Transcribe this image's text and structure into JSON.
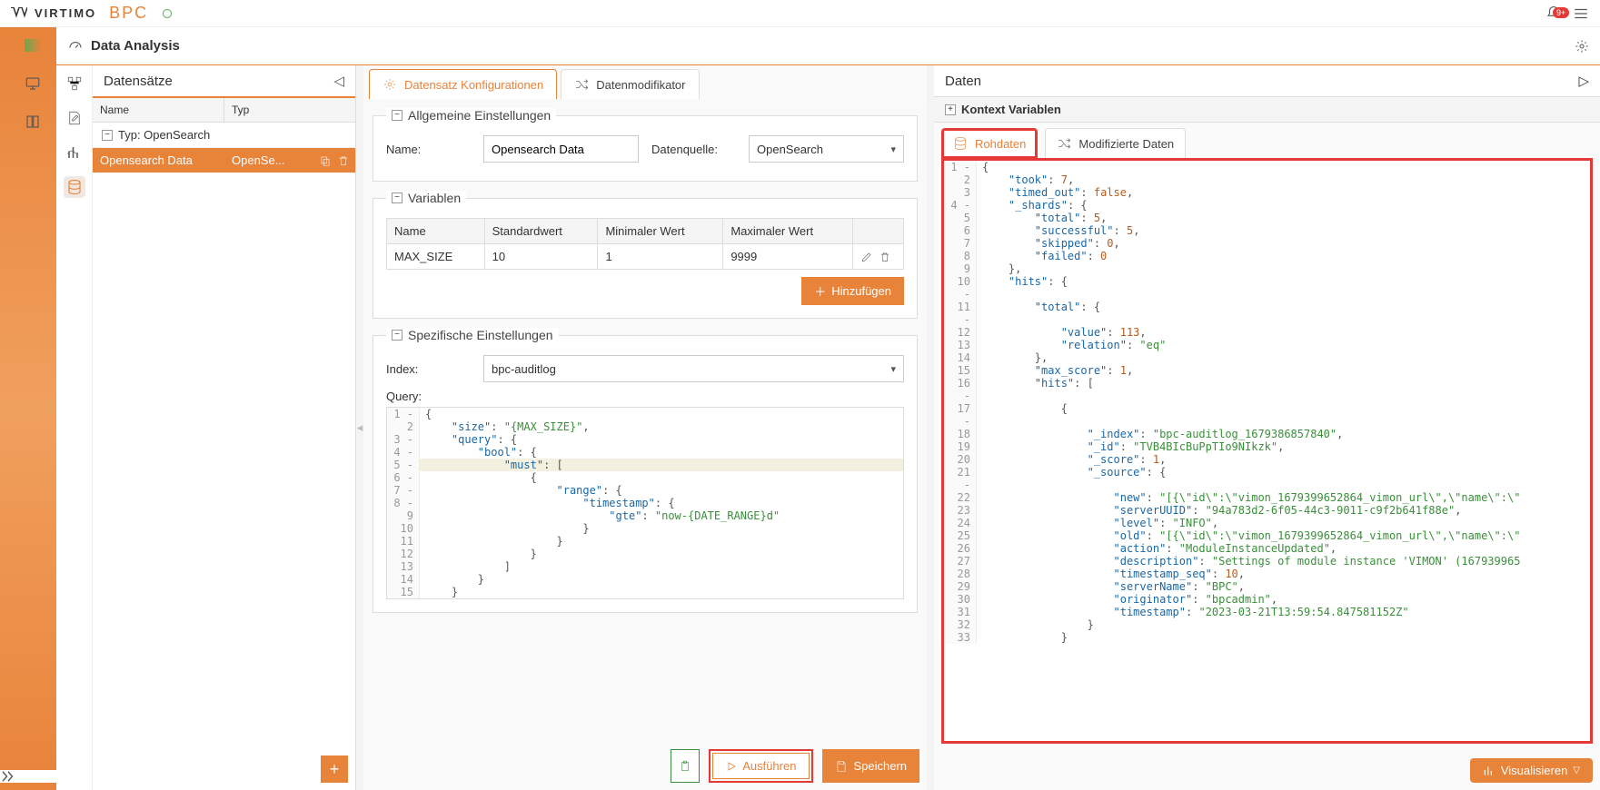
{
  "header": {
    "brand_main": "VIRTIMO",
    "brand_sub": "BPC",
    "badge": "9+"
  },
  "page": {
    "title": "Data Analysis"
  },
  "datasets": {
    "panel_title": "Datensätze",
    "columns": {
      "name": "Name",
      "type": "Typ"
    },
    "group_label": "Typ: OpenSearch",
    "rows": [
      {
        "name": "Opensearch Data",
        "type": "OpenSe..."
      }
    ]
  },
  "center": {
    "tabs": {
      "config": "Datensatz Konfigurationen",
      "modifier": "Datenmodifikator"
    },
    "general": {
      "legend": "Allgemeine Einstellungen",
      "name_label": "Name:",
      "name_value": "Opensearch Data",
      "source_label": "Datenquelle:",
      "source_value": "OpenSearch"
    },
    "variables": {
      "legend": "Variablen",
      "cols": {
        "name": "Name",
        "std": "Standardwert",
        "min": "Minimaler Wert",
        "max": "Maximaler Wert"
      },
      "rows": [
        {
          "name": "MAX_SIZE",
          "std": "10",
          "min": "1",
          "max": "9999"
        }
      ],
      "add_btn": "Hinzufügen"
    },
    "specific": {
      "legend": "Spezifische Einstellungen",
      "index_label": "Index:",
      "index_value": "bpc-auditlog",
      "query_label": "Query:"
    },
    "query_lines": [
      {
        "n": "1",
        "fold": "-",
        "tokens": [
          {
            "t": "{",
            "c": "p"
          }
        ]
      },
      {
        "n": "2",
        "tokens": [
          {
            "t": "    ",
            "c": "p"
          },
          {
            "t": "\"size\"",
            "c": "k"
          },
          {
            "t": ": ",
            "c": "p"
          },
          {
            "t": "\"{MAX_SIZE}\"",
            "c": "s"
          },
          {
            "t": ",",
            "c": "p"
          }
        ]
      },
      {
        "n": "3",
        "fold": "-",
        "tokens": [
          {
            "t": "    ",
            "c": "p"
          },
          {
            "t": "\"query\"",
            "c": "k"
          },
          {
            "t": ": {",
            "c": "p"
          }
        ]
      },
      {
        "n": "4",
        "fold": "-",
        "tokens": [
          {
            "t": "        ",
            "c": "p"
          },
          {
            "t": "\"bool\"",
            "c": "k"
          },
          {
            "t": ": {",
            "c": "p"
          }
        ]
      },
      {
        "n": "5",
        "fold": "-",
        "hl": true,
        "tokens": [
          {
            "t": "            ",
            "c": "p"
          },
          {
            "t": "\"must\"",
            "c": "k"
          },
          {
            "t": ": [",
            "c": "p"
          }
        ]
      },
      {
        "n": "6",
        "fold": "-",
        "tokens": [
          {
            "t": "                {",
            "c": "p"
          }
        ]
      },
      {
        "n": "7",
        "fold": "-",
        "tokens": [
          {
            "t": "                    ",
            "c": "p"
          },
          {
            "t": "\"range\"",
            "c": "k"
          },
          {
            "t": ": {",
            "c": "p"
          }
        ]
      },
      {
        "n": "8",
        "fold": "-",
        "tokens": [
          {
            "t": "                        ",
            "c": "p"
          },
          {
            "t": "\"timestamp\"",
            "c": "k"
          },
          {
            "t": ": {",
            "c": "p"
          }
        ]
      },
      {
        "n": "9",
        "tokens": [
          {
            "t": "                            ",
            "c": "p"
          },
          {
            "t": "\"gte\"",
            "c": "k"
          },
          {
            "t": ": ",
            "c": "p"
          },
          {
            "t": "\"now-{DATE_RANGE}d\"",
            "c": "s"
          }
        ]
      },
      {
        "n": "10",
        "tokens": [
          {
            "t": "                        }",
            "c": "p"
          }
        ]
      },
      {
        "n": "11",
        "tokens": [
          {
            "t": "                    }",
            "c": "p"
          }
        ]
      },
      {
        "n": "12",
        "tokens": [
          {
            "t": "                }",
            "c": "p"
          }
        ]
      },
      {
        "n": "13",
        "tokens": [
          {
            "t": "            ]",
            "c": "p"
          }
        ]
      },
      {
        "n": "14",
        "tokens": [
          {
            "t": "        }",
            "c": "p"
          }
        ]
      },
      {
        "n": "15",
        "tokens": [
          {
            "t": "    }",
            "c": "p"
          }
        ]
      }
    ],
    "footer": {
      "execute": "Ausführen",
      "save": "Speichern"
    }
  },
  "right": {
    "title": "Daten",
    "context": "Kontext Variablen",
    "tabs": {
      "raw": "Rohdaten",
      "mod": "Modifizierte Daten"
    },
    "json_lines": [
      {
        "n": "1",
        "fold": "-",
        "tokens": [
          {
            "t": "{",
            "c": "p"
          }
        ]
      },
      {
        "n": "2",
        "tokens": [
          {
            "t": "    ",
            "c": "p"
          },
          {
            "t": "\"took\"",
            "c": "k"
          },
          {
            "t": ": ",
            "c": "p"
          },
          {
            "t": "7",
            "c": "n"
          },
          {
            "t": ",",
            "c": "p"
          }
        ]
      },
      {
        "n": "3",
        "tokens": [
          {
            "t": "    ",
            "c": "p"
          },
          {
            "t": "\"timed_out\"",
            "c": "k"
          },
          {
            "t": ": ",
            "c": "p"
          },
          {
            "t": "false",
            "c": "n"
          },
          {
            "t": ",",
            "c": "p"
          }
        ]
      },
      {
        "n": "4",
        "fold": "-",
        "tokens": [
          {
            "t": "    ",
            "c": "p"
          },
          {
            "t": "\"_shards\"",
            "c": "k"
          },
          {
            "t": ": {",
            "c": "p"
          }
        ]
      },
      {
        "n": "5",
        "tokens": [
          {
            "t": "        ",
            "c": "p"
          },
          {
            "t": "\"total\"",
            "c": "k"
          },
          {
            "t": ": ",
            "c": "p"
          },
          {
            "t": "5",
            "c": "n"
          },
          {
            "t": ",",
            "c": "p"
          }
        ]
      },
      {
        "n": "6",
        "tokens": [
          {
            "t": "        ",
            "c": "p"
          },
          {
            "t": "\"successful\"",
            "c": "k"
          },
          {
            "t": ": ",
            "c": "p"
          },
          {
            "t": "5",
            "c": "n"
          },
          {
            "t": ",",
            "c": "p"
          }
        ]
      },
      {
        "n": "7",
        "tokens": [
          {
            "t": "        ",
            "c": "p"
          },
          {
            "t": "\"skipped\"",
            "c": "k"
          },
          {
            "t": ": ",
            "c": "p"
          },
          {
            "t": "0",
            "c": "n"
          },
          {
            "t": ",",
            "c": "p"
          }
        ]
      },
      {
        "n": "8",
        "tokens": [
          {
            "t": "        ",
            "c": "p"
          },
          {
            "t": "\"failed\"",
            "c": "k"
          },
          {
            "t": ": ",
            "c": "p"
          },
          {
            "t": "0",
            "c": "n"
          }
        ]
      },
      {
        "n": "9",
        "tokens": [
          {
            "t": "    },",
            "c": "p"
          }
        ]
      },
      {
        "n": "10",
        "fold": "-",
        "tokens": [
          {
            "t": "    ",
            "c": "p"
          },
          {
            "t": "\"hits\"",
            "c": "k"
          },
          {
            "t": ": {",
            "c": "p"
          }
        ]
      },
      {
        "n": "11",
        "fold": "-",
        "tokens": [
          {
            "t": "        ",
            "c": "p"
          },
          {
            "t": "\"total\"",
            "c": "k"
          },
          {
            "t": ": {",
            "c": "p"
          }
        ]
      },
      {
        "n": "12",
        "tokens": [
          {
            "t": "            ",
            "c": "p"
          },
          {
            "t": "\"value\"",
            "c": "k"
          },
          {
            "t": ": ",
            "c": "p"
          },
          {
            "t": "113",
            "c": "n"
          },
          {
            "t": ",",
            "c": "p"
          }
        ]
      },
      {
        "n": "13",
        "tokens": [
          {
            "t": "            ",
            "c": "p"
          },
          {
            "t": "\"relation\"",
            "c": "k"
          },
          {
            "t": ": ",
            "c": "p"
          },
          {
            "t": "\"eq\"",
            "c": "s"
          }
        ]
      },
      {
        "n": "14",
        "tokens": [
          {
            "t": "        },",
            "c": "p"
          }
        ]
      },
      {
        "n": "15",
        "tokens": [
          {
            "t": "        ",
            "c": "p"
          },
          {
            "t": "\"max_score\"",
            "c": "k"
          },
          {
            "t": ": ",
            "c": "p"
          },
          {
            "t": "1",
            "c": "n"
          },
          {
            "t": ",",
            "c": "p"
          }
        ]
      },
      {
        "n": "16",
        "fold": "-",
        "tokens": [
          {
            "t": "        ",
            "c": "p"
          },
          {
            "t": "\"hits\"",
            "c": "k"
          },
          {
            "t": ": [",
            "c": "p"
          }
        ]
      },
      {
        "n": "17",
        "fold": "-",
        "tokens": [
          {
            "t": "            {",
            "c": "p"
          }
        ]
      },
      {
        "n": "18",
        "tokens": [
          {
            "t": "                ",
            "c": "p"
          },
          {
            "t": "\"_index\"",
            "c": "k"
          },
          {
            "t": ": ",
            "c": "p"
          },
          {
            "t": "\"bpc-auditlog_1679386857840\"",
            "c": "s"
          },
          {
            "t": ",",
            "c": "p"
          }
        ]
      },
      {
        "n": "19",
        "tokens": [
          {
            "t": "                ",
            "c": "p"
          },
          {
            "t": "\"_id\"",
            "c": "k"
          },
          {
            "t": ": ",
            "c": "p"
          },
          {
            "t": "\"TVB4BIcBuPpTIo9NIkzk\"",
            "c": "s"
          },
          {
            "t": ",",
            "c": "p"
          }
        ]
      },
      {
        "n": "20",
        "tokens": [
          {
            "t": "                ",
            "c": "p"
          },
          {
            "t": "\"_score\"",
            "c": "k"
          },
          {
            "t": ": ",
            "c": "p"
          },
          {
            "t": "1",
            "c": "n"
          },
          {
            "t": ",",
            "c": "p"
          }
        ]
      },
      {
        "n": "21",
        "fold": "-",
        "tokens": [
          {
            "t": "                ",
            "c": "p"
          },
          {
            "t": "\"_source\"",
            "c": "k"
          },
          {
            "t": ": {",
            "c": "p"
          }
        ]
      },
      {
        "n": "22",
        "tokens": [
          {
            "t": "                    ",
            "c": "p"
          },
          {
            "t": "\"new\"",
            "c": "k"
          },
          {
            "t": ": ",
            "c": "p"
          },
          {
            "t": "\"[{\\\"id\\\":\\\"vimon_1679399652864_vimon_url\\\",\\\"name\\\":\\\"",
            "c": "s"
          }
        ]
      },
      {
        "n": "23",
        "tokens": [
          {
            "t": "                    ",
            "c": "p"
          },
          {
            "t": "\"serverUUID\"",
            "c": "k"
          },
          {
            "t": ": ",
            "c": "p"
          },
          {
            "t": "\"94a783d2-6f05-44c3-9011-c9f2b641f88e\"",
            "c": "s"
          },
          {
            "t": ",",
            "c": "p"
          }
        ]
      },
      {
        "n": "24",
        "tokens": [
          {
            "t": "                    ",
            "c": "p"
          },
          {
            "t": "\"level\"",
            "c": "k"
          },
          {
            "t": ": ",
            "c": "p"
          },
          {
            "t": "\"INFO\"",
            "c": "s"
          },
          {
            "t": ",",
            "c": "p"
          }
        ]
      },
      {
        "n": "25",
        "tokens": [
          {
            "t": "                    ",
            "c": "p"
          },
          {
            "t": "\"old\"",
            "c": "k"
          },
          {
            "t": ": ",
            "c": "p"
          },
          {
            "t": "\"[{\\\"id\\\":\\\"vimon_1679399652864_vimon_url\\\",\\\"name\\\":\\\"",
            "c": "s"
          }
        ]
      },
      {
        "n": "26",
        "tokens": [
          {
            "t": "                    ",
            "c": "p"
          },
          {
            "t": "\"action\"",
            "c": "k"
          },
          {
            "t": ": ",
            "c": "p"
          },
          {
            "t": "\"ModuleInstanceUpdated\"",
            "c": "s"
          },
          {
            "t": ",",
            "c": "p"
          }
        ]
      },
      {
        "n": "27",
        "tokens": [
          {
            "t": "                    ",
            "c": "p"
          },
          {
            "t": "\"description\"",
            "c": "k"
          },
          {
            "t": ": ",
            "c": "p"
          },
          {
            "t": "\"Settings of module instance 'VIMON' (167939965",
            "c": "s"
          }
        ]
      },
      {
        "n": "28",
        "tokens": [
          {
            "t": "                    ",
            "c": "p"
          },
          {
            "t": "\"timestamp_seq\"",
            "c": "k"
          },
          {
            "t": ": ",
            "c": "p"
          },
          {
            "t": "10",
            "c": "n"
          },
          {
            "t": ",",
            "c": "p"
          }
        ]
      },
      {
        "n": "29",
        "tokens": [
          {
            "t": "                    ",
            "c": "p"
          },
          {
            "t": "\"serverName\"",
            "c": "k"
          },
          {
            "t": ": ",
            "c": "p"
          },
          {
            "t": "\"BPC\"",
            "c": "s"
          },
          {
            "t": ",",
            "c": "p"
          }
        ]
      },
      {
        "n": "30",
        "tokens": [
          {
            "t": "                    ",
            "c": "p"
          },
          {
            "t": "\"originator\"",
            "c": "k"
          },
          {
            "t": ": ",
            "c": "p"
          },
          {
            "t": "\"bpcadmin\"",
            "c": "s"
          },
          {
            "t": ",",
            "c": "p"
          }
        ]
      },
      {
        "n": "31",
        "tokens": [
          {
            "t": "                    ",
            "c": "p"
          },
          {
            "t": "\"timestamp\"",
            "c": "k"
          },
          {
            "t": ": ",
            "c": "p"
          },
          {
            "t": "\"2023-03-21T13:59:54.847581152Z\"",
            "c": "s"
          }
        ]
      },
      {
        "n": "32",
        "tokens": [
          {
            "t": "                }",
            "c": "p"
          }
        ]
      },
      {
        "n": "33",
        "tokens": [
          {
            "t": "            }",
            "c": "p"
          }
        ]
      }
    ],
    "visualize": "Visualisieren"
  }
}
